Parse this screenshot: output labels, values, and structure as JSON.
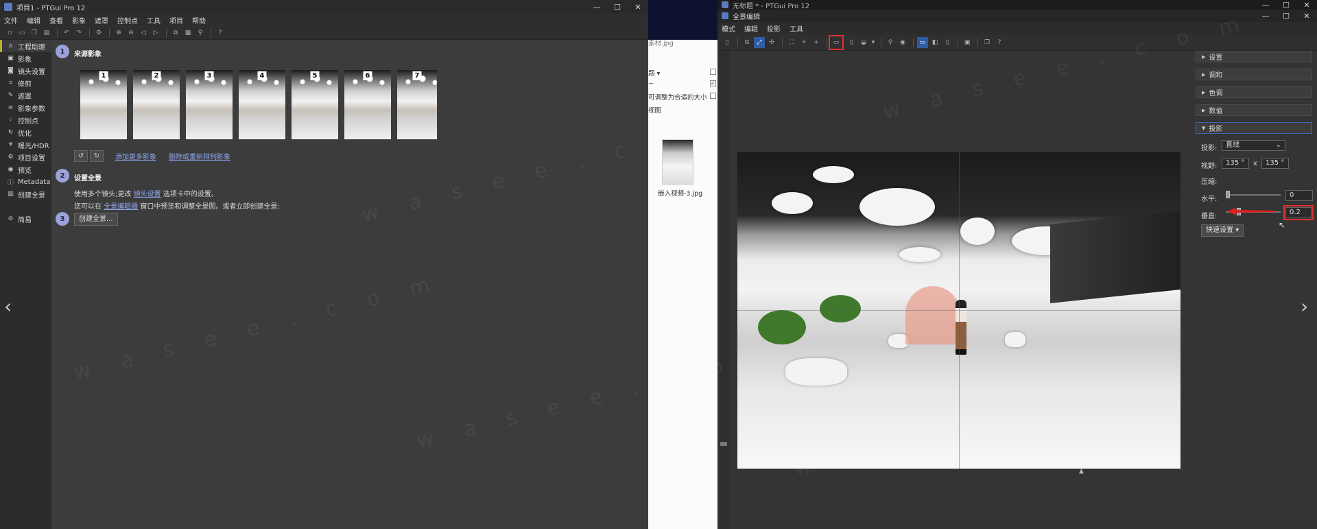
{
  "left_window": {
    "title": "项目1 - PTGui Pro 12",
    "menu": [
      "文件",
      "编辑",
      "查看",
      "影象",
      "遮罩",
      "控制点",
      "工具",
      "项目",
      "帮助"
    ],
    "sidebar": [
      {
        "label": "工程助理",
        "icon": "home-icon"
      },
      {
        "label": "影象",
        "icon": "image-icon"
      },
      {
        "label": "镜头设置",
        "icon": "camera-icon"
      },
      {
        "label": "修剪",
        "icon": "crop-icon"
      },
      {
        "label": "遮罩",
        "icon": "brush-icon"
      },
      {
        "label": "影象参数",
        "icon": "sliders-icon"
      },
      {
        "label": "控制点",
        "icon": "control-points-icon"
      },
      {
        "label": "优化",
        "icon": "optimize-icon"
      },
      {
        "label": "曝光/HDR",
        "icon": "exposure-icon"
      },
      {
        "label": "项目设置",
        "icon": "settings-icon"
      },
      {
        "label": "预览",
        "icon": "eye-icon"
      },
      {
        "label": "Metadata",
        "icon": "info-icon"
      },
      {
        "label": "创建全景",
        "icon": "panorama-icon"
      }
    ],
    "sidebar_simple": "简易",
    "step1": {
      "num": "1",
      "title": "来源影象",
      "thumb_numbers": [
        "1",
        "2",
        "3",
        "4",
        "5",
        "6",
        "7"
      ],
      "add_link": "添加更多影象",
      "remove_link": "删除或重新排列影象"
    },
    "step2": {
      "num": "2",
      "title": "设置全景",
      "line1_pre": "使用多个镜头;更改",
      "line1_link": "镜头设置",
      "line1_post": "选项卡中的设置。",
      "line2_pre": "您可以在",
      "line2_link": "全景编辑器",
      "line2_post": "窗口中预览和调整全景图。或者立即创建全景:"
    },
    "step3": {
      "num": "3",
      "button": "创建全景..."
    }
  },
  "explorer": {
    "file_top": "素材.jpg",
    "row1": "题 ▾",
    "row2": "~",
    "row3": "可调整为合适的大小",
    "row4": "视图",
    "file_name": "嵌入视频-3.jpg"
  },
  "right_window": {
    "top_title": "无标题 * - PTGui Pro 12",
    "title": "全景编辑",
    "menu": [
      "模式",
      "编辑",
      "投影",
      "工具"
    ],
    "panel": {
      "sections": [
        "设置",
        "调和",
        "色调",
        "数值",
        "投影"
      ],
      "projection_label": "投影:",
      "projection_value": "直线",
      "fov_label": "视野:",
      "fov_h": "135 °",
      "fov_x": "x",
      "fov_v": "135 °",
      "compress_label": "压缩:",
      "horizontal_label": "水平:",
      "horizontal_value": "0",
      "vertical_label": "垂直:",
      "vertical_value": "0.2",
      "quick_settings": "快速设置 ▾"
    },
    "accent_color": "#e03030"
  },
  "watermark": "w a s e e . c o m"
}
